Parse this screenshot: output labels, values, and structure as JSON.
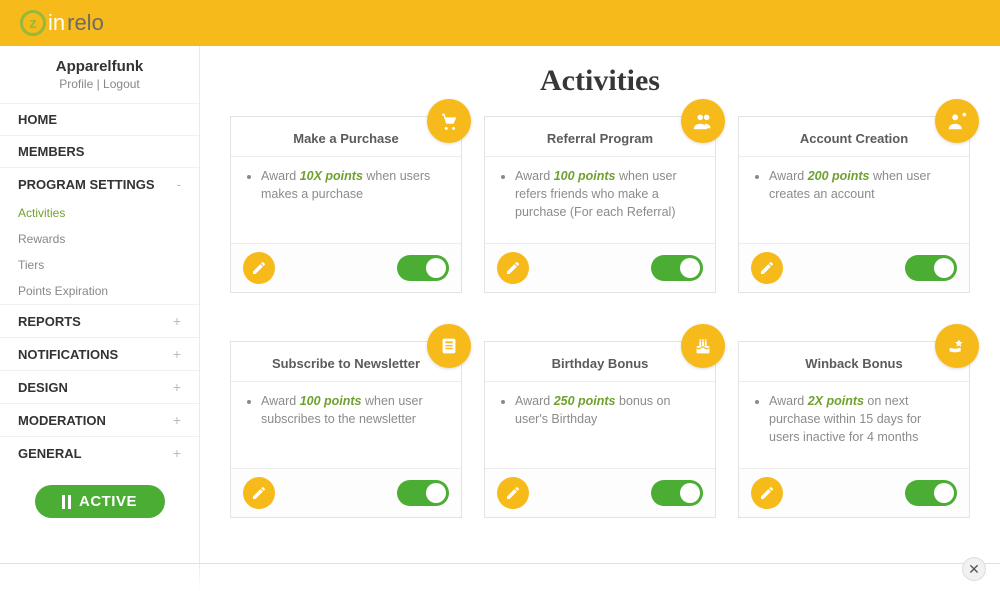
{
  "brand": {
    "name_primary": "in",
    "name_secondary": "relo"
  },
  "account": {
    "name": "Apparelfunk",
    "profile_label": "Profile",
    "logout_label": "Logout"
  },
  "sidebar": {
    "items": [
      {
        "label": "HOME",
        "expandable": false
      },
      {
        "label": "MEMBERS",
        "expandable": false
      },
      {
        "label": "PROGRAM SETTINGS",
        "expandable": true,
        "expanded": true,
        "symbol": "-",
        "children": [
          {
            "label": "Activities",
            "active": true
          },
          {
            "label": "Rewards",
            "active": false
          },
          {
            "label": "Tiers",
            "active": false
          },
          {
            "label": "Points Expiration",
            "active": false
          }
        ]
      },
      {
        "label": "REPORTS",
        "expandable": true,
        "symbol": "+"
      },
      {
        "label": "NOTIFICATIONS",
        "expandable": true,
        "symbol": "+"
      },
      {
        "label": "DESIGN",
        "expandable": true,
        "symbol": "+"
      },
      {
        "label": "MODERATION",
        "expandable": true,
        "symbol": "+"
      },
      {
        "label": "GENERAL",
        "expandable": true,
        "symbol": "+"
      }
    ],
    "status_label": "ACTIVE"
  },
  "page": {
    "title": "Activities"
  },
  "cards": [
    {
      "title": "Make a Purchase",
      "icon": "cart-icon",
      "desc_pre": "Award ",
      "desc_bold": "10X points",
      "desc_post": " when users makes a purchase",
      "enabled": true
    },
    {
      "title": "Referral Program",
      "icon": "users-icon",
      "desc_pre": "Award ",
      "desc_bold": "100 points",
      "desc_post": " when user refers friends who make a purchase (For each Referral)",
      "enabled": true
    },
    {
      "title": "Account Creation",
      "icon": "user-plus-icon",
      "desc_pre": "Award ",
      "desc_bold": "200 points",
      "desc_post": " when user creates an account",
      "enabled": true
    },
    {
      "title": "Subscribe to Newsletter",
      "icon": "newsletter-icon",
      "desc_pre": "Award ",
      "desc_bold": "100 points",
      "desc_post": " when user subscribes to the newsletter",
      "enabled": true
    },
    {
      "title": "Birthday Bonus",
      "icon": "cake-icon",
      "desc_pre": "Award ",
      "desc_bold": "250 points",
      "desc_post": " bonus on user's Birthday",
      "enabled": true
    },
    {
      "title": "Winback Bonus",
      "icon": "reward-icon",
      "desc_pre": "Award ",
      "desc_bold": "2X points",
      "desc_post": " on next purchase within 15 days for users inactive for 4 months",
      "enabled": true
    }
  ],
  "colors": {
    "accent_yellow": "#f6bb1a",
    "accent_green": "#4bad33",
    "text_green": "#6fa12e"
  }
}
